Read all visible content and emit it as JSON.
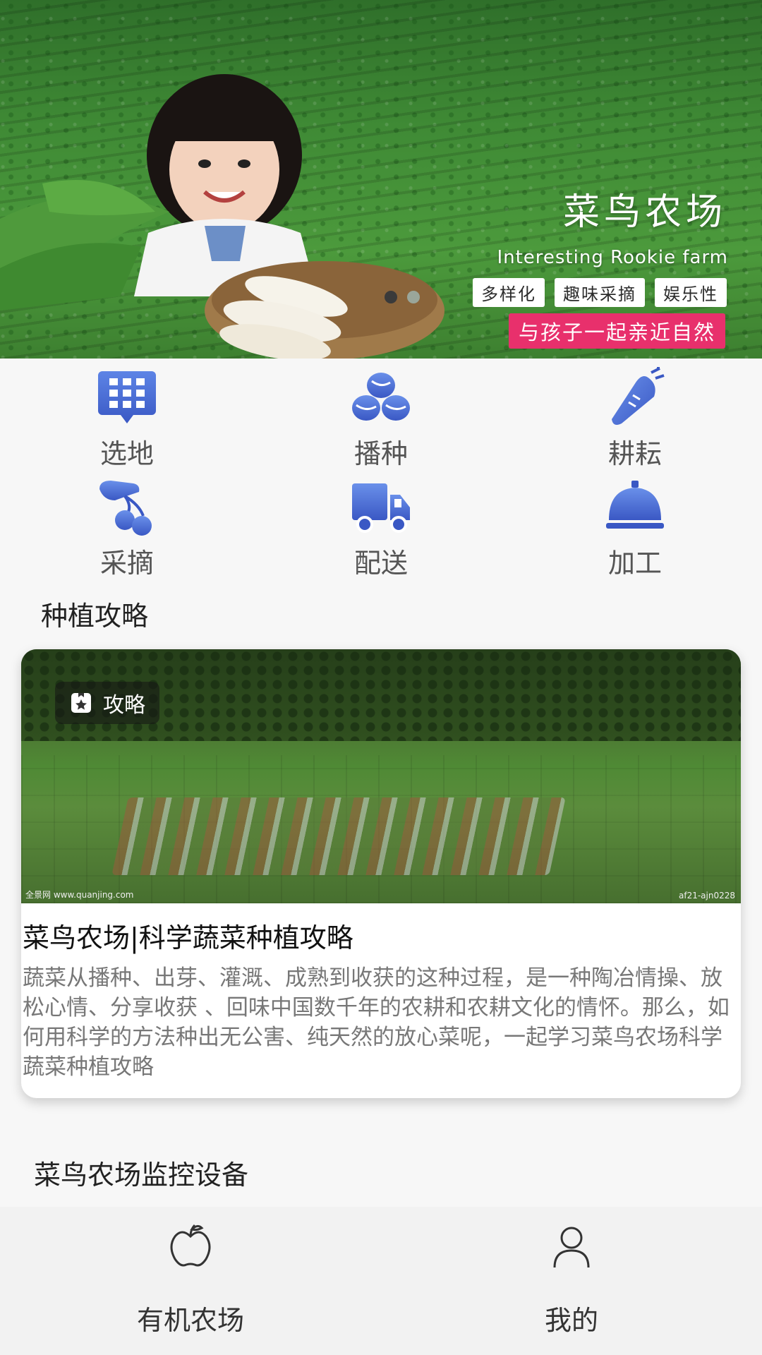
{
  "banner": {
    "title": "菜鸟农场",
    "subtitle": "Interesting Rookie farm",
    "tags": [
      "多样化",
      "趣味采摘",
      "娱乐性"
    ],
    "slogan": "与孩子一起亲近自然"
  },
  "grid": {
    "items": [
      {
        "label": "选地",
        "icon": "grid-pin-icon"
      },
      {
        "label": "播种",
        "icon": "seeds-icon"
      },
      {
        "label": "耕耘",
        "icon": "carrot-icon"
      },
      {
        "label": "采摘",
        "icon": "hand-cherry-icon"
      },
      {
        "label": "配送",
        "icon": "truck-icon"
      },
      {
        "label": "加工",
        "icon": "cloche-icon"
      }
    ]
  },
  "section1": {
    "title": "种植攻略"
  },
  "article": {
    "badge": "攻略",
    "watermark_left": "全景网 www.quanjing.com",
    "watermark_right": "af21-ajn0228",
    "title": "菜鸟农场|科学蔬菜种植攻略",
    "description": "蔬菜从播种、出芽、灌溉、成熟到收获的这种过程，是一种陶冶情操、放松心情、分享收获 、回味中国数千年的农耕和农耕文化的情怀。那么，如何用科学的方法种出无公害、纯天然的放心菜呢，一起学习菜鸟农场科学蔬菜种植攻略"
  },
  "section2": {
    "title": "菜鸟农场监控设备"
  },
  "tabbar": {
    "tabs": [
      {
        "label": "有机农场",
        "icon": "apple-icon"
      },
      {
        "label": "我的",
        "icon": "person-icon"
      }
    ]
  },
  "colors": {
    "accent_blue": "#4a6fd8",
    "slogan_pink": "#e8306c"
  }
}
